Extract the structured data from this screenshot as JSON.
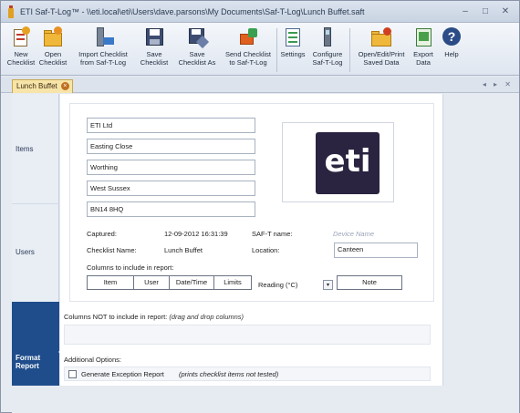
{
  "window": {
    "title": "ETI Saf-T-Log™ - \\\\eti.local\\eti\\Users\\dave.parsons\\My Documents\\Saf-T-Log\\Lunch Buffet.saft",
    "controls": [
      "–",
      "□",
      "✕"
    ]
  },
  "ribbon": {
    "buttons": [
      {
        "id": "new",
        "label": "New\nChecklist",
        "icon": "new-checklist-icon"
      },
      {
        "id": "open",
        "label": "Open\nChecklist",
        "icon": "open-folder-icon"
      },
      {
        "id": "import",
        "label": "Import Checklist\nfrom Saf-T-Log",
        "icon": "import-device-icon"
      },
      {
        "id": "save",
        "label": "Save\nChecklist",
        "icon": "save-disk-icon"
      },
      {
        "id": "saveas",
        "label": "Save\nChecklist As",
        "icon": "save-as-icon"
      },
      {
        "id": "send",
        "label": "Send Checklist\nto Saf-T-Log",
        "icon": "send-device-icon"
      },
      {
        "id": "settings",
        "label": "Settings",
        "icon": "settings-list-icon"
      },
      {
        "id": "configure",
        "label": "Configure\nSaf-T-Log",
        "icon": "configure-device-icon"
      },
      {
        "id": "openedit",
        "label": "Open/Edit/Print\nSaved Data",
        "icon": "saved-data-folder-icon"
      },
      {
        "id": "export",
        "label": "Export\nData",
        "icon": "export-spreadsheet-icon"
      },
      {
        "id": "help",
        "label": "Help",
        "icon": "help-question-icon"
      }
    ]
  },
  "tabs": {
    "document": "Lunch Buffet",
    "nav_arrows": "◂ ▸ ✕"
  },
  "sidebar": {
    "items": [
      "Items",
      "Users",
      "Format\nReport"
    ],
    "active": "Format\nReport"
  },
  "report": {
    "address": [
      "ETI Ltd",
      "Easting Close",
      "Worthing",
      "West Sussex",
      "BN14 8HQ"
    ],
    "logo_text": "eti",
    "captured_label": "Captured:",
    "captured_value": "12-09-2012 16:31:39",
    "saft_name_label": "SAF-T name:",
    "saft_name_placeholder": "Device Name",
    "checklist_label": "Checklist Name:",
    "checklist_value": "Lunch Buffet",
    "location_label": "Location:",
    "location_value": "Canteen",
    "columns_label": "Columns to include in report:",
    "columns": [
      "Item",
      "User",
      "Date/Time",
      "Limits"
    ],
    "reading_label": "Reading (°C)",
    "note_label": "Note"
  },
  "excluded": {
    "heading": "Columns NOT to include in report:",
    "hint": "(drag and drop columns)"
  },
  "options": {
    "heading": "Additional Options:",
    "exception_label": "Generate Exception Report",
    "exception_hint": "(prints checklist items not tested)",
    "exception_checked": false
  }
}
